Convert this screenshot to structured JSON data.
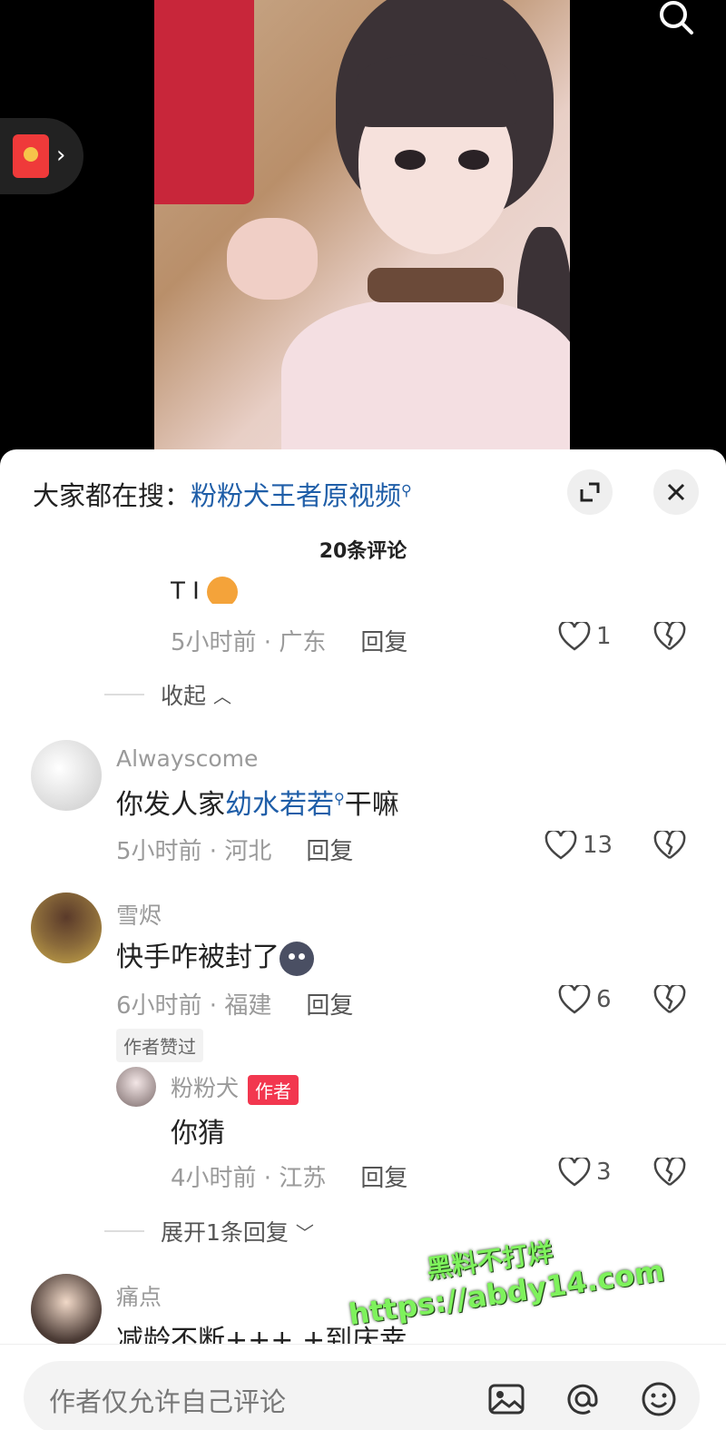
{
  "video": {
    "description_icon": "search-icon"
  },
  "trend": {
    "prefix": "大家都在搜：",
    "keyword": "粉粉犬王者原视频"
  },
  "comments_count": "20条评论",
  "truncated_reply": {
    "text": "T I",
    "time_loc": "5小时前 · 广东",
    "reply": "回复",
    "likes": "1"
  },
  "collapse_label": "收起",
  "comments": [
    {
      "user": "Alwayscome",
      "text_before": "你发人家",
      "keyword": "幼水若若",
      "text_after": "干嘛",
      "time_loc": "5小时前 · 河北",
      "reply": "回复",
      "likes": "13"
    },
    {
      "user": "雪烬",
      "text": "快手咋被封了",
      "time_loc": "6小时前 · 福建",
      "reply": "回复",
      "likes": "6",
      "badge": "作者赞过"
    },
    {
      "user": "痛点",
      "text": "减龄不断+++ +到庆幸"
    }
  ],
  "author_reply": {
    "user": "粉粉犬",
    "tag": "作者",
    "text": "你猜",
    "time_loc": "4小时前 · 江苏",
    "reply": "回复",
    "likes": "3"
  },
  "expand_label": "展开1条回复",
  "input": {
    "placeholder": "作者仅允许自己评论"
  },
  "watermark": {
    "line1": "黑料不打烊",
    "line2": "https://abdy14.com"
  },
  "colors": {
    "link": "#1f5ea8",
    "author_tag": "#f2374f",
    "watermark": "#7ef25c"
  }
}
